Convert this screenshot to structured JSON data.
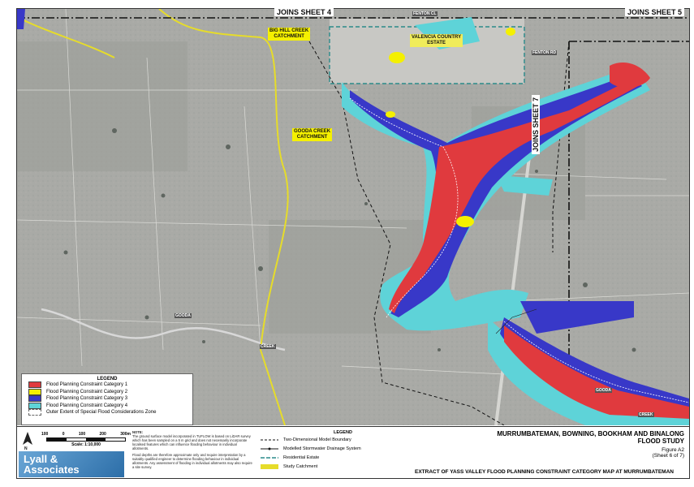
{
  "sheets": {
    "top_left": "JOINS SHEET 4",
    "top_right": "JOINS SHEET 5",
    "right": "JOINS SHEET 7"
  },
  "map_labels": {
    "big_hill": "BIG HILL CREEK\nCATCHMENT",
    "gooda": "GOODA CREEK\nCATCHMENT",
    "valencia": "VALENCIA COUNTRY\nESTATE",
    "gooda_road": "GOODA",
    "creek_road": "CREEK",
    "gooda_right": "GOODA",
    "creek_right": "CREEK",
    "fenton": "FENTON CL",
    "fenton2": "FENTON RD"
  },
  "legend_map": {
    "title": "LEGEND",
    "items": [
      {
        "label": "Flood Planning Constraint Category 1",
        "color": "#e03a3e"
      },
      {
        "label": "Flood Planning Constraint Category 2",
        "color": "#f4f000"
      },
      {
        "label": "Flood Planning Constraint Category 3",
        "color": "#3838c8"
      },
      {
        "label": "Flood Planning Constraint Category 4",
        "color": "#5ed3d8"
      },
      {
        "label": "Outer Extent of Special Flood Considerations Zone",
        "color": "#ffffff"
      }
    ]
  },
  "scale": {
    "ticks": [
      "100",
      "0",
      "100",
      "200",
      "300m"
    ],
    "label": "Scale: 1:10,000",
    "north": "N"
  },
  "note": {
    "title": "NOTE:",
    "p1": "The ground surface model incorporated in TUFLOW is based on LiDAR survey which has been sampled on a 5 m grid and does not necessarily incorporate localised features which can influence flooding behaviour in individual allotments.",
    "p2": "Flood depths are therefore approximate only and require interpretation by a suitably qualified engineer to determine flooding behaviour in individual allotments. Any assessment of flooding in individual allotments may also require a site survey."
  },
  "logo": {
    "line1": "Lyall &",
    "line2": "Associates"
  },
  "legend_bottom": {
    "title": "LEGEND",
    "items": [
      "Two-Dimensional Model Boundary",
      "Modelled Stormwater Drainage System",
      "Residential Estate",
      "Study Catchment"
    ]
  },
  "title_block": {
    "title1": "MURRUMBATEMAN, BOWNING, BOOKHAM AND BINALONG",
    "title2": "FLOOD STUDY",
    "figure": "Figure A2",
    "sheet": "(Sheet 6 of 7)",
    "caption": "EXTRACT OF YASS VALLEY FLOOD PLANNING CONSTRAINT CATEGORY MAP AT MURRUMBATEMAN"
  }
}
